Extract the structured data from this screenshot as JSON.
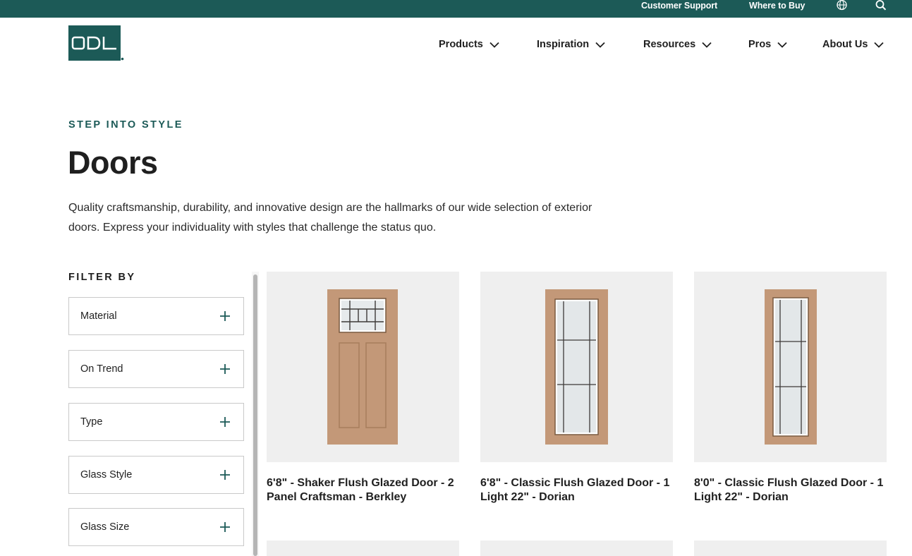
{
  "topbar": {
    "customer_support": "Customer Support",
    "where_to_buy": "Where to Buy",
    "globe_icon": "globe-icon",
    "search_icon": "search-icon"
  },
  "header": {
    "logo_text": "ODL",
    "nav": [
      {
        "label": "Products"
      },
      {
        "label": "Inspiration"
      },
      {
        "label": "Resources"
      },
      {
        "label": "Pros"
      },
      {
        "label": "About Us"
      }
    ]
  },
  "hero": {
    "eyebrow": "STEP INTO STYLE",
    "title": "Doors",
    "description": "Quality craftsmanship, durability, and innovative design are the hallmarks of our wide selection of exterior doors. Express your individuality with styles that challenge the status quo."
  },
  "filters": {
    "title": "FILTER BY",
    "items": [
      {
        "label": "Material"
      },
      {
        "label": "On Trend"
      },
      {
        "label": "Type"
      },
      {
        "label": "Glass Style"
      },
      {
        "label": "Glass Size"
      }
    ]
  },
  "products": [
    {
      "title": "6'8\" - Shaker Flush Glazed Door - 2 Panel Craftsman - Berkley"
    },
    {
      "title": "6'8\" - Classic Flush Glazed Door - 1 Light 22\" - Dorian"
    },
    {
      "title": "8'0\" - Classic Flush Glazed Door - 1 Light 22\" - Dorian"
    }
  ],
  "colors": {
    "brand_green": "#1c5a57",
    "door_wood": "#c39878",
    "card_bg": "#efefef"
  }
}
